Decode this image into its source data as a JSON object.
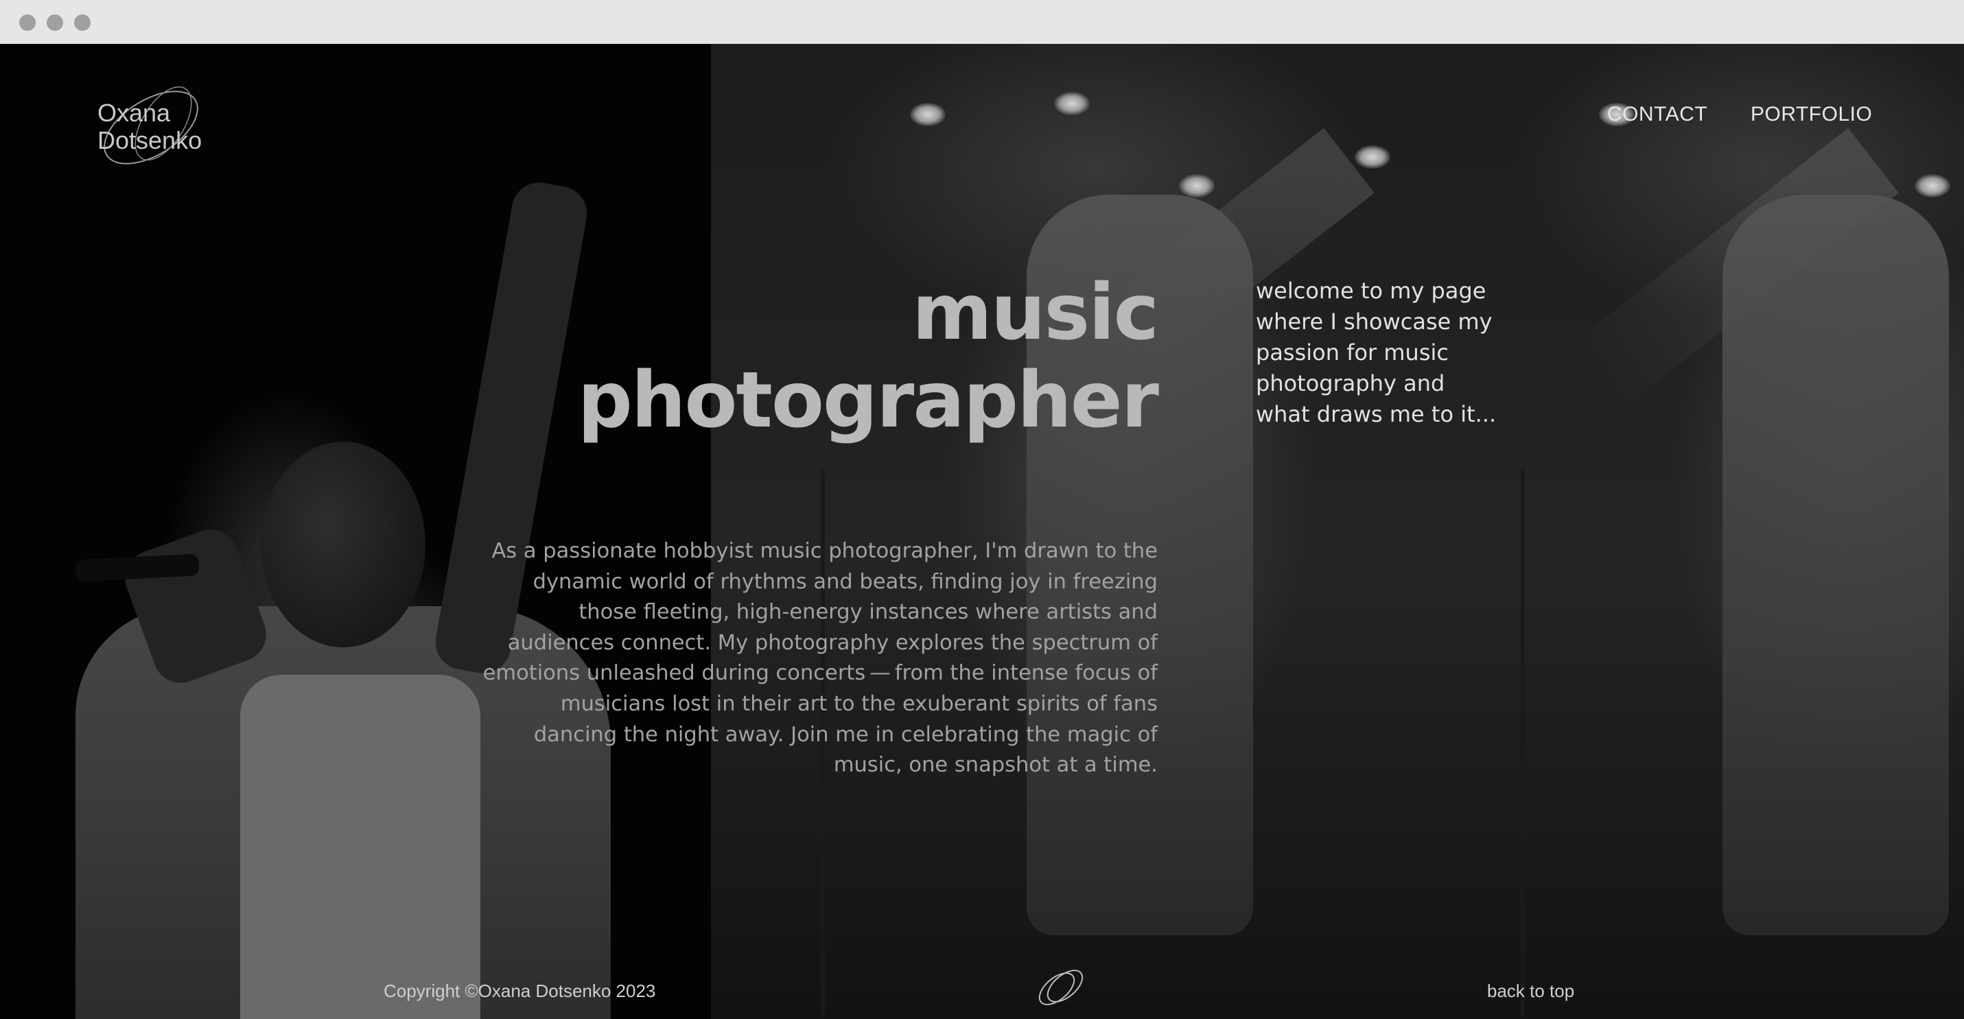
{
  "header": {
    "logo": {
      "line1": "Oxana",
      "line2": "Dotsenko"
    },
    "nav": [
      {
        "label": "CONTACT"
      },
      {
        "label": "PORTFOLIO"
      }
    ]
  },
  "hero": {
    "headline_line1": "music",
    "headline_line2": "photographer",
    "welcome": "welcome to my page where I showcase my passion for music photography and what draws me to it...",
    "intro": "As a passionate hobbyist music photographer, I'm drawn to the dynamic world of rhythms and beats, finding joy in freezing those fleeting, high-energy instances where artists and audiences connect. My photography explores the spectrum of emotions unleashed during concerts — from the intense focus of musicians lost in their art to the exuberant spirits of fans dancing the night away. Join me in celebrating the magic of music, one snapshot at a time."
  },
  "footer": {
    "copyright": "Copyright ©Oxana Dotsenko 2023",
    "back_to_top": "back to top"
  },
  "colors": {
    "background": "#000000",
    "headline": "#b9b9b9",
    "body_text": "#a2a2a2",
    "nav_text": "#e8e8e8",
    "chrome": "#e6e6e6"
  }
}
